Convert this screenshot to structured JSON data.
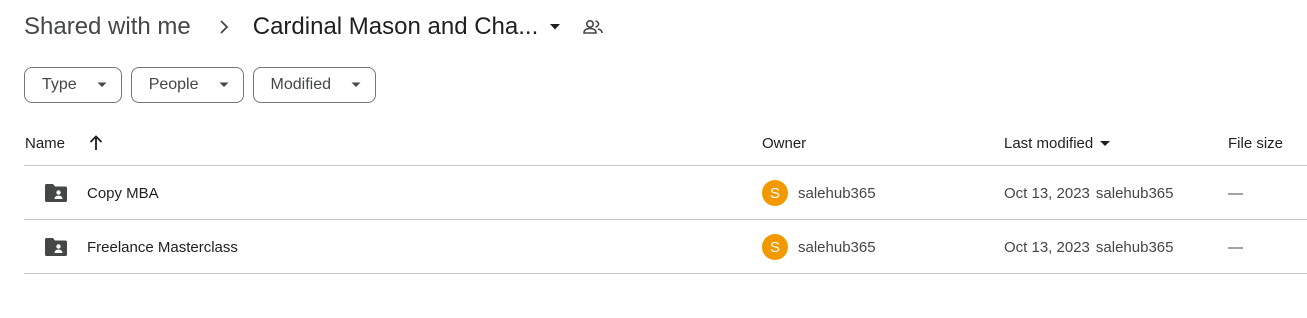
{
  "breadcrumb": {
    "root": "Shared with me",
    "current": "Cardinal Mason and Cha..."
  },
  "filters": [
    {
      "label": "Type"
    },
    {
      "label": "People"
    },
    {
      "label": "Modified"
    }
  ],
  "columns": {
    "name": "Name",
    "owner": "Owner",
    "last_modified": "Last modified",
    "file_size": "File size"
  },
  "rows": [
    {
      "name": "Copy MBA",
      "icon": "shared-folder-icon",
      "owner_initial": "S",
      "owner": "salehub365",
      "modified_date": "Oct 13, 2023",
      "modified_by": "salehub365",
      "size": "—"
    },
    {
      "name": "Freelance Masterclass",
      "icon": "shared-folder-icon",
      "owner_initial": "S",
      "owner": "salehub365",
      "modified_date": "Oct 13, 2023",
      "modified_by": "salehub365",
      "size": "—"
    }
  ],
  "colors": {
    "avatar": "#f29900",
    "divider": "#c7c7c7",
    "chip_border": "#747775"
  }
}
